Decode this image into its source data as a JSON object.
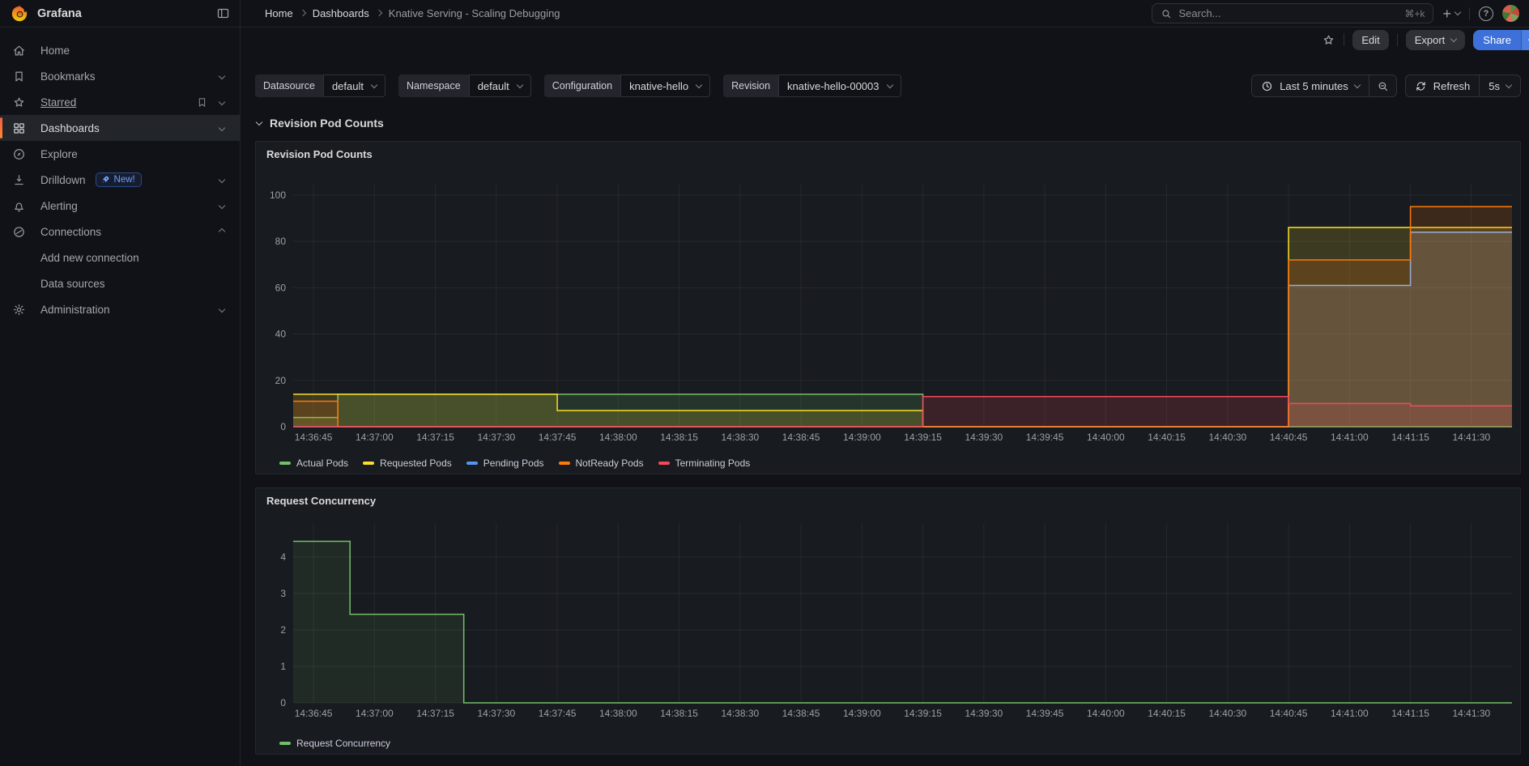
{
  "header": {
    "brand": "Grafana",
    "breadcrumb": [
      "Home",
      "Dashboards",
      "Knative Serving - Scaling Debugging"
    ],
    "search": {
      "placeholder": "Search...",
      "shortcut": "⌘+k"
    }
  },
  "icons": {
    "plus": "+",
    "help": "?"
  },
  "toolbar": {
    "edit": "Edit",
    "export": "Export",
    "share": "Share"
  },
  "sidebar": {
    "items": [
      {
        "label": "Home",
        "icon": "home-icon"
      },
      {
        "label": "Bookmarks",
        "icon": "bookmark-icon",
        "chevron": "down"
      },
      {
        "label": "Starred",
        "icon": "star-icon",
        "chevron": "down"
      },
      {
        "label": "Dashboards",
        "icon": "apps-icon",
        "chevron": "down",
        "active": true
      },
      {
        "label": "Explore",
        "icon": "compass-icon"
      },
      {
        "label": "Drilldown",
        "icon": "drilldown-icon",
        "badge": "New!",
        "chevron": "down"
      },
      {
        "label": "Alerting",
        "icon": "bell-icon",
        "chevron": "down"
      },
      {
        "label": "Connections",
        "icon": "plug-icon",
        "chevron": "up"
      },
      {
        "label": "Add new connection"
      },
      {
        "label": "Data sources"
      },
      {
        "label": "Administration",
        "icon": "gear-icon",
        "chevron": "down"
      }
    ]
  },
  "variables": [
    {
      "label": "Datasource",
      "value": "default"
    },
    {
      "label": "Namespace",
      "value": "default"
    },
    {
      "label": "Configuration",
      "value": "knative-hello"
    },
    {
      "label": "Revision",
      "value": "knative-hello-00003"
    }
  ],
  "time_controls": {
    "range": "Last 5 minutes",
    "refresh": "Refresh",
    "interval": "5s"
  },
  "section": {
    "title": "Revision Pod Counts"
  },
  "chart_data": [
    {
      "type": "line",
      "step": true,
      "title": "Revision Pod Counts",
      "x_ticks": [
        "14:36:45",
        "14:37:00",
        "14:37:15",
        "14:37:30",
        "14:37:45",
        "14:38:00",
        "14:38:15",
        "14:38:30",
        "14:38:45",
        "14:39:00",
        "14:39:15",
        "14:39:30",
        "14:39:45",
        "14:40:00",
        "14:40:15",
        "14:40:30",
        "14:40:45",
        "14:41:00",
        "14:41:15",
        "14:41:30"
      ],
      "x_tick_step_seconds": 15,
      "x_range_seconds": [
        -5,
        295
      ],
      "y_ticks": [
        0,
        20,
        40,
        60,
        80,
        100
      ],
      "y_max": 104.5,
      "grid": true,
      "legend_position": "bottom",
      "fill_opacity": 0.16,
      "series": [
        {
          "name": "Actual Pods",
          "color": "#73bf69",
          "points": [
            [
              -5,
              4
            ],
            [
              6,
              14
            ],
            [
              150,
              0
            ]
          ]
        },
        {
          "name": "Requested Pods",
          "color": "#fade2a",
          "points": [
            [
              -5,
              14
            ],
            [
              60,
              7
            ],
            [
              150,
              0
            ],
            [
              240,
              86
            ]
          ]
        },
        {
          "name": "Pending Pods",
          "color": "#5794f2",
          "line_color": "#8ab8ff",
          "points": [
            [
              -5,
              0
            ],
            [
              240,
              61
            ],
            [
              270,
              84
            ]
          ]
        },
        {
          "name": "NotReady Pods",
          "color": "#ff780a",
          "points": [
            [
              -5,
              11
            ],
            [
              6,
              0
            ],
            [
              240,
              72
            ],
            [
              270,
              95
            ]
          ]
        },
        {
          "name": "Terminating Pods",
          "color": "#f2495c",
          "points": [
            [
              -5,
              0
            ],
            [
              150,
              13
            ],
            [
              240,
              10
            ],
            [
              270,
              9
            ]
          ]
        }
      ]
    },
    {
      "type": "line",
      "step": true,
      "title": "Request Concurrency",
      "x_ticks": [
        "14:36:45",
        "14:37:00",
        "14:37:15",
        "14:37:30",
        "14:37:45",
        "14:38:00",
        "14:38:15",
        "14:38:30",
        "14:38:45",
        "14:39:00",
        "14:39:15",
        "14:39:30",
        "14:39:45",
        "14:40:00",
        "14:40:15",
        "14:40:30",
        "14:40:45",
        "14:41:00",
        "14:41:15",
        "14:41:30"
      ],
      "x_tick_step_seconds": 15,
      "x_range_seconds": [
        -5,
        295
      ],
      "y_ticks": [
        0,
        1,
        2,
        3,
        4
      ],
      "y_max": 4.93,
      "grid": true,
      "legend_position": "bottom",
      "fill_opacity": 0.1,
      "series": [
        {
          "name": "Request Concurrency",
          "color": "#73bf69",
          "points": [
            [
              -5,
              4.43
            ],
            [
              9,
              2.43
            ],
            [
              37,
              0
            ]
          ]
        }
      ]
    }
  ]
}
